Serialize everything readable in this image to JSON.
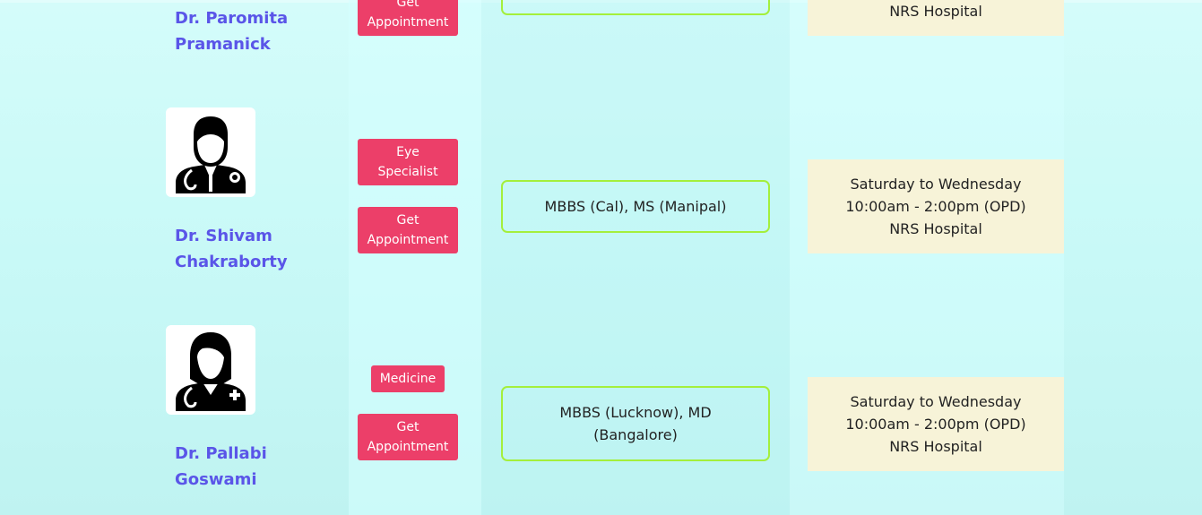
{
  "doctors": [
    {
      "name": "Dr. Paromita\nPramanick",
      "appointment_label": "Get\nAppointment",
      "schedule_last_line": "NRS Hospital"
    },
    {
      "name": "Dr. Shivam\nChakraborty",
      "specialty": "Eye\nSpecialist",
      "appointment_label": "Get\nAppointment",
      "qualification": "MBBS (Cal), MS (Manipal)",
      "schedule": "Saturday to Wednesday\n10:00am - 2:00pm (OPD)\nNRS Hospital",
      "avatar_icon": "male-doctor-icon"
    },
    {
      "name": "Dr. Pallabi\nGoswami",
      "specialty": "Medicine",
      "appointment_label": "Get\nAppointment",
      "qualification": "MBBS (Lucknow), MD (Bangalore)",
      "schedule": "Saturday to Wednesday\n10:00am - 2:00pm (OPD)\nNRS Hospital",
      "avatar_icon": "female-doctor-icon"
    }
  ],
  "colors": {
    "name": "#5a55e8",
    "button": "#ec3f69",
    "qual_border": "#a4ef3c",
    "schedule_bg": "#f7f3d8"
  }
}
